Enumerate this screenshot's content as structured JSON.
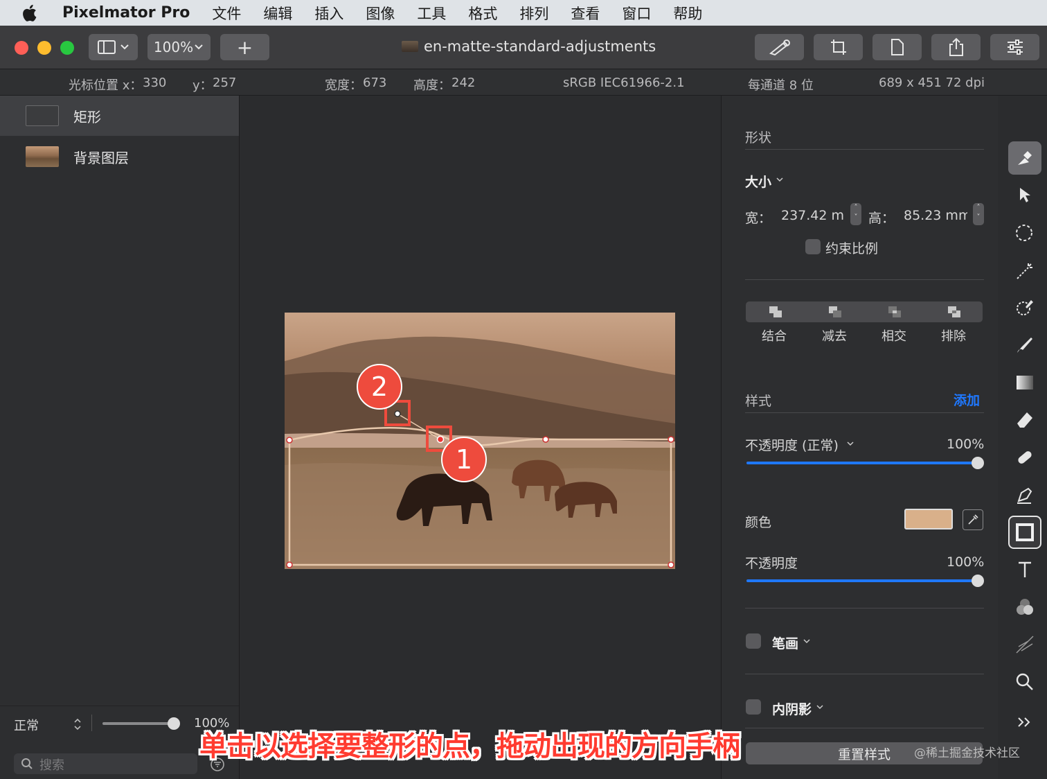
{
  "menubar": {
    "app_name": "Pixelmator Pro",
    "items": [
      "文件",
      "编辑",
      "插入",
      "图像",
      "工具",
      "格式",
      "排列",
      "查看",
      "窗口",
      "帮助"
    ]
  },
  "toolbar": {
    "zoom": "100%",
    "add_label": "+",
    "document_title": "en-matte-standard-adjustments"
  },
  "infobar": {
    "cursor_x_label": "光标位置 x：",
    "cursor_x": "330",
    "cursor_y_label": "y：",
    "cursor_y": "257",
    "width_label": "宽度：",
    "width": "673",
    "height_label": "高度：",
    "height": "242",
    "color_profile": "sRGB IEC61966-2.1",
    "bit_depth": "每通道 8 位",
    "image_size": "689 x 451 72 dpi"
  },
  "layers": {
    "items": [
      {
        "name": "矩形",
        "selected": true
      },
      {
        "name": "背景图层",
        "selected": false
      }
    ],
    "blend_mode": "正常",
    "opacity": "100%",
    "search_placeholder": "搜索"
  },
  "canvas": {
    "marker_1": "1",
    "marker_2": "2"
  },
  "inspector": {
    "shape_section": "形状",
    "size_label": "大小",
    "width_label": "宽：",
    "width_value": "237.42 mı",
    "height_label": "高：",
    "height_value": "85.23 mm",
    "constrain_label": "约束比例",
    "boolean_ops": [
      "结合",
      "减去",
      "相交",
      "排除"
    ],
    "style_section": "样式",
    "add_label": "添加",
    "opacity_normal_label": "不透明度 (正常)",
    "opacity_normal_value": "100%",
    "opacity_normal_fraction": 1.0,
    "color_label": "颜色",
    "color_swatch": "#d9b08a",
    "fill_opacity_label": "不透明度",
    "fill_opacity_value": "100%",
    "fill_opacity_fraction": 1.0,
    "stroke_label": "笔画",
    "inner_shadow_label": "内阴影",
    "reset_label": "重置样式"
  },
  "toolbox": {
    "tools": [
      "style-tool-icon",
      "arrange-tool-icon",
      "selection-tool-icon",
      "magic-wand-icon",
      "color-adjust-icon",
      "paint-icon",
      "gradient-icon",
      "eraser-icon",
      "retouch-icon",
      "pen-icon",
      "shape-icon",
      "text-icon",
      "color-blend-icon",
      "distort-icon",
      "zoom-icon",
      "more-icon"
    ]
  },
  "overlay": {
    "caption": "单击以选择要整形的点，拖动出现的方向手柄",
    "watermark": "@稀土掘金技术社区"
  },
  "colors": {
    "accent_blue": "#1f78ff",
    "marker_red": "#ee4b3d",
    "caption_red": "#ff3b30"
  }
}
